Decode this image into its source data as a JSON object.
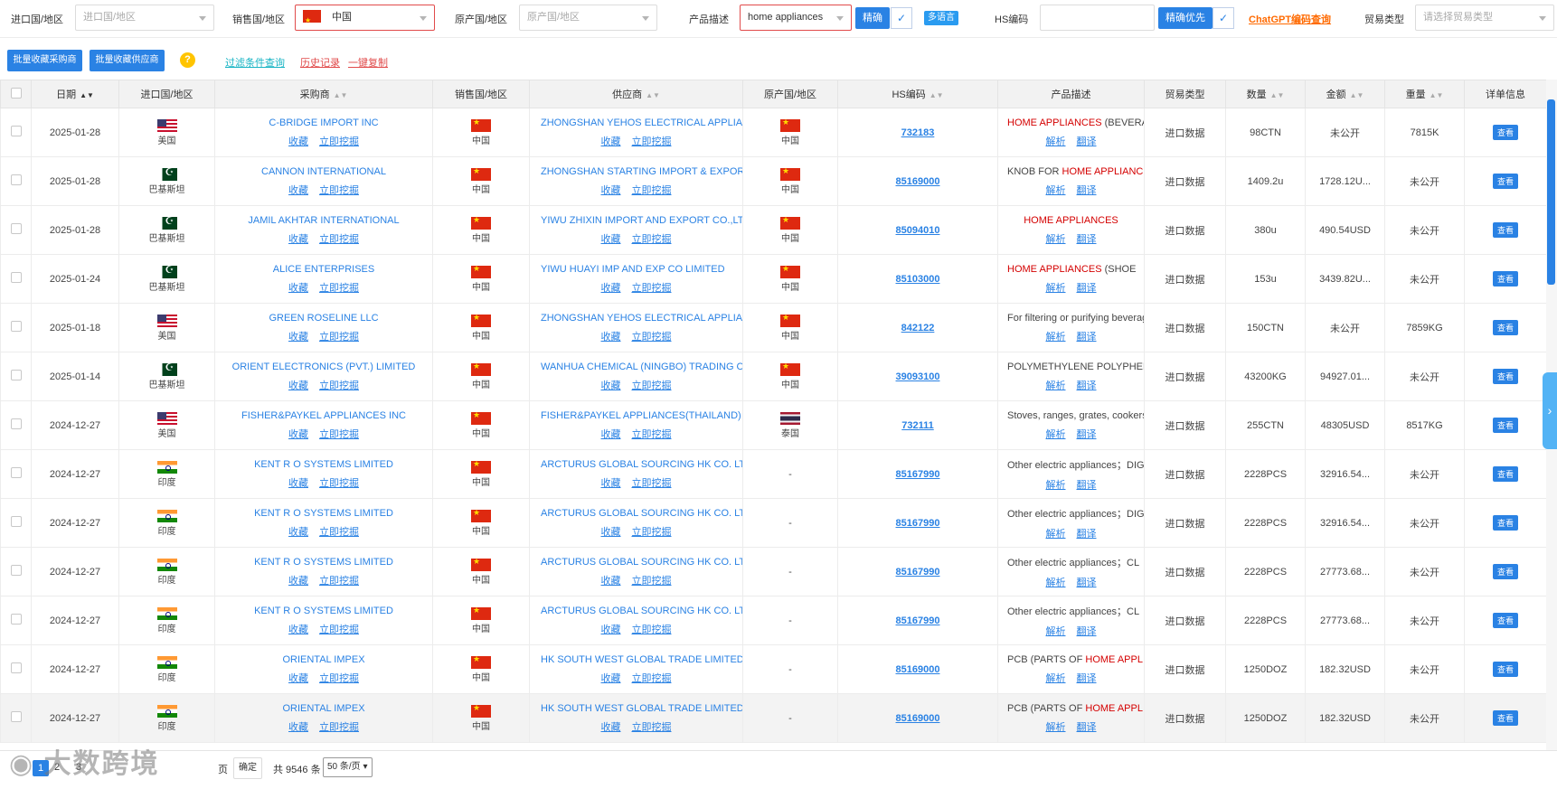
{
  "filters": {
    "import_country_label": "进口国/地区",
    "import_country_placeholder": "进口国/地区",
    "sales_country_label": "销售国/地区",
    "sales_country_value": "中国",
    "origin_country_label": "原产国/地区",
    "origin_country_placeholder": "原产国/地区",
    "product_desc_label": "产品描述",
    "product_desc_value": "home appliances",
    "exact_btn": "精确",
    "multilang_tag": "多语言",
    "hs_label": "HS编码",
    "exact_priority_btn": "精确优先",
    "chatgpt_link": "ChatGPT编码查询",
    "trade_type_label": "贸易类型",
    "trade_type_placeholder": "请选择贸易类型"
  },
  "actions": {
    "batch_buyer": "批量收藏采购商",
    "batch_supplier": "批量收藏供应商",
    "help": "?",
    "filter_query": "过滤条件查询",
    "history": "历史记录",
    "copy_all": "一键复制"
  },
  "table": {
    "columns": [
      "日期",
      "进口国/地区",
      "采购商",
      "销售国/地区",
      "供应商",
      "原产国/地区",
      "HS编码",
      "产品描述",
      "贸易类型",
      "数量",
      "金额",
      "重量",
      "详单信息"
    ],
    "action_fav": "收藏",
    "action_mine": "立即挖掘",
    "action_parse": "解析",
    "action_translate": "翻译",
    "view_btn": "查看",
    "rows": [
      {
        "date": "2025-01-28",
        "imp_flag": "us",
        "imp": "美国",
        "buyer": "C-BRIDGE IMPORT INC",
        "sales": "中国",
        "supplier": "ZHONGSHAN YEHOS ELECTRICAL APPLIANCE",
        "origin_flag": "cn",
        "origin": "中国",
        "hs": "732183",
        "desc_pre": "",
        "desc_hl": "HOME APPLIANCES",
        "desc_post": " (BEVERAGE",
        "trade": "进口数据",
        "qty": "98CTN",
        "amount": "未公开",
        "weight": "7815K"
      },
      {
        "date": "2025-01-28",
        "imp_flag": "pk",
        "imp": "巴基斯坦",
        "buyer": "CANNON INTERNATIONAL",
        "sales": "中国",
        "supplier": "ZHONGSHAN STARTING IMPORT & EXPORT",
        "origin_flag": "cn",
        "origin": "中国",
        "hs": "85169000",
        "desc_pre": "KNOB FOR ",
        "desc_hl": "HOME APPLIANCES",
        "desc_post": "",
        "trade": "进口数据",
        "qty": "1409.2u",
        "amount": "1728.12U...",
        "weight": "未公开"
      },
      {
        "date": "2025-01-28",
        "imp_flag": "pk",
        "imp": "巴基斯坦",
        "buyer": "JAMIL AKHTAR INTERNATIONAL",
        "sales": "中国",
        "supplier": "YIWU ZHIXIN IMPORT AND EXPORT CO.,LTD",
        "origin_flag": "cn",
        "origin": "中国",
        "hs": "85094010",
        "desc_pre": "",
        "desc_hl": "HOME APPLIANCES",
        "desc_post": "",
        "trade": "进口数据",
        "qty": "380u",
        "amount": "490.54USD",
        "weight": "未公开",
        "center_desc": true
      },
      {
        "date": "2025-01-24",
        "imp_flag": "pk",
        "imp": "巴基斯坦",
        "buyer": "ALICE ENTERPRISES",
        "sales": "中国",
        "supplier": "YIWU HUAYI IMP AND EXP CO LIMITED",
        "origin_flag": "cn",
        "origin": "中国",
        "hs": "85103000",
        "desc_pre": "",
        "desc_hl": "HOME APPLIANCES",
        "desc_post": " (SHOE",
        "trade": "进口数据",
        "qty": "153u",
        "amount": "3439.82U...",
        "weight": "未公开"
      },
      {
        "date": "2025-01-18",
        "imp_flag": "us",
        "imp": "美国",
        "buyer": "GREEN ROSELINE LLC",
        "sales": "中国",
        "supplier": "ZHONGSHAN YEHOS ELECTRICAL APPLIANCE",
        "origin_flag": "cn",
        "origin": "中国",
        "hs": "842122",
        "desc_pre": "For filtering or purifying beverages",
        "desc_hl": "",
        "desc_post": "",
        "trade": "进口数据",
        "qty": "150CTN",
        "amount": "未公开",
        "weight": "7859KG"
      },
      {
        "date": "2025-01-14",
        "imp_flag": "pk",
        "imp": "巴基斯坦",
        "buyer": "ORIENT ELECTRONICS (PVT.) LIMITED",
        "sales": "中国",
        "supplier": "WANHUA CHEMICAL (NINGBO) TRADING CO",
        "origin_flag": "cn",
        "origin": "中国",
        "hs": "39093100",
        "desc_pre": "POLYMETHYLENE POLYPHENYL",
        "desc_hl": "",
        "desc_post": "",
        "trade": "进口数据",
        "qty": "43200KG",
        "amount": "94927.01...",
        "weight": "未公开"
      },
      {
        "date": "2024-12-27",
        "imp_flag": "us",
        "imp": "美国",
        "buyer": "FISHER&PAYKEL APPLIANCES INC",
        "sales": "中国",
        "supplier": "FISHER&PAYKEL APPLIANCES(THAILAND)",
        "origin_flag": "th",
        "origin": "泰国",
        "hs": "732111",
        "desc_pre": "Stoves, ranges, grates, cookers",
        "desc_hl": "",
        "desc_post": "",
        "trade": "进口数据",
        "qty": "255CTN",
        "amount": "48305USD",
        "weight": "8517KG"
      },
      {
        "date": "2024-12-27",
        "imp_flag": "in",
        "imp": "印度",
        "buyer": "KENT R O SYSTEMS LIMITED",
        "sales": "中国",
        "supplier": "ARCTURUS GLOBAL SOURCING HK CO. LTD",
        "origin_flag": "",
        "origin": "-",
        "hs": "85167990",
        "desc_pre": "Other electric appliances；DIG",
        "desc_hl": "",
        "desc_post": "",
        "trade": "进口数据",
        "qty": "2228PCS",
        "amount": "32916.54...",
        "weight": "未公开"
      },
      {
        "date": "2024-12-27",
        "imp_flag": "in",
        "imp": "印度",
        "buyer": "KENT R O SYSTEMS LIMITED",
        "sales": "中国",
        "supplier": "ARCTURUS GLOBAL SOURCING HK CO. LTD",
        "origin_flag": "",
        "origin": "-",
        "hs": "85167990",
        "desc_pre": "Other electric appliances；DIG",
        "desc_hl": "",
        "desc_post": "",
        "trade": "进口数据",
        "qty": "2228PCS",
        "amount": "32916.54...",
        "weight": "未公开"
      },
      {
        "date": "2024-12-27",
        "imp_flag": "in",
        "imp": "印度",
        "buyer": "KENT R O SYSTEMS LIMITED",
        "sales": "中国",
        "supplier": "ARCTURUS GLOBAL SOURCING HK CO. LTD",
        "origin_flag": "",
        "origin": "-",
        "hs": "85167990",
        "desc_pre": "Other electric appliances；CL",
        "desc_hl": "",
        "desc_post": "",
        "trade": "进口数据",
        "qty": "2228PCS",
        "amount": "27773.68...",
        "weight": "未公开"
      },
      {
        "date": "2024-12-27",
        "imp_flag": "in",
        "imp": "印度",
        "buyer": "KENT R O SYSTEMS LIMITED",
        "sales": "中国",
        "supplier": "ARCTURUS GLOBAL SOURCING HK CO. LTD",
        "origin_flag": "",
        "origin": "-",
        "hs": "85167990",
        "desc_pre": "Other electric appliances；CL",
        "desc_hl": "",
        "desc_post": "",
        "trade": "进口数据",
        "qty": "2228PCS",
        "amount": "27773.68...",
        "weight": "未公开"
      },
      {
        "date": "2024-12-27",
        "imp_flag": "in",
        "imp": "印度",
        "buyer": "ORIENTAL IMPEX",
        "sales": "中国",
        "supplier": "HK SOUTH WEST GLOBAL TRADE LIMITED",
        "origin_flag": "",
        "origin": "-",
        "hs": "85169000",
        "desc_pre": "PCB (PARTS OF ",
        "desc_hl": "HOME APPLIANCES",
        "desc_post": "",
        "trade": "进口数据",
        "qty": "1250DOZ",
        "amount": "182.32USD",
        "weight": "未公开"
      },
      {
        "date": "2024-12-27",
        "imp_flag": "in",
        "imp": "印度",
        "buyer": "ORIENTAL IMPEX",
        "sales": "中国",
        "supplier": "HK SOUTH WEST GLOBAL TRADE LIMITED",
        "origin_flag": "",
        "origin": "-",
        "hs": "85169000",
        "desc_pre": "PCB (PARTS OF ",
        "desc_hl": "HOME APPLIANCES",
        "desc_post": "",
        "trade": "进口数据",
        "qty": "1250DOZ",
        "amount": "182.32USD",
        "weight": "未公开",
        "highlight": true
      }
    ]
  },
  "pager": {
    "pages": [
      "1",
      "2",
      "3"
    ],
    "current": "1",
    "page_suffix": "页",
    "confirm": "确定",
    "total": "共 9546 条",
    "page_size": "50 条/页"
  },
  "watermark": "大数跨境"
}
